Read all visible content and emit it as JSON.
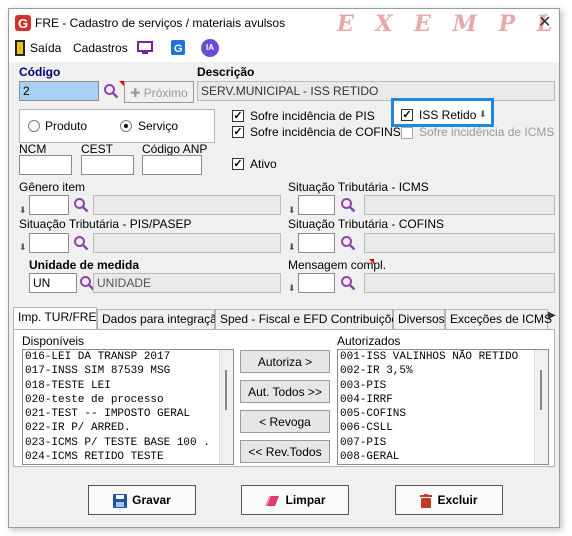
{
  "window": {
    "title": "FRE - Cadastro de serviços / materiais avulsos",
    "watermark": "E X E M P L O",
    "close_glyph": "✕"
  },
  "menu": {
    "exit": "Saída",
    "registers": "Cadastros",
    "ia": "IA"
  },
  "codigo": {
    "label": "Código",
    "value": "2",
    "next_button": "Próximo"
  },
  "descricao": {
    "label": "Descrição",
    "value": "SERV.MUNICIPAL - ISS RETIDO"
  },
  "tipo": {
    "produto": "Produto",
    "servico": "Serviço",
    "selected": "Serviço"
  },
  "flags": {
    "pis": "Sofre incidência de PIS",
    "cofins": "Sofre incidência de COFINS",
    "iss_retido": "ISS Retido",
    "icms": "Sofre incidência de ICMS",
    "ativo": "Ativo"
  },
  "fields": {
    "ncm": "NCM",
    "cest": "CEST",
    "codigo_anp": "Código ANP",
    "genero_item": "Gênero item",
    "sit_icms": "Situação Tributária - ICMS",
    "sit_pis": "Situação Tributária - PIS/PASEP",
    "sit_cofins": "Situação Tributária - COFINS",
    "unidade": "Unidade de medida",
    "unidade_code": "UN",
    "unidade_desc": "UNIDADE",
    "mensagem": "Mensagem compl."
  },
  "tabs": [
    "Imp. TUR/FRE",
    "Dados para integração",
    "Sped - Fiscal e EFD Contribuições",
    "Diversos",
    "Exceções de ICMS"
  ],
  "disponiveis": {
    "label": "Disponíveis",
    "items": [
      "016-LEI DA TRANSP 2017",
      "017-INSS SIM 87539 MSG",
      "018-TESTE LEI",
      "020-teste de processo",
      "021-TEST -- IMPOSTO GERAL",
      "022-IR P/ ARRED.",
      "023-ICMS P/ TESTE BASE 100 .",
      "024-ICMS RETIDO TESTE"
    ]
  },
  "autorizados": {
    "label": "Autorizados",
    "items": [
      "001-ISS VALINHOS NÃO RETIDO",
      "002-IR 3,5%",
      "003-PIS",
      "004-IRRF",
      "005-COFINS",
      "006-CSLL",
      "007-PIS",
      "008-GERAL"
    ]
  },
  "transfer": {
    "autoriza": "Autoriza >",
    "aut_todos": "Aut. Todos >>",
    "revoga": "< Revoga",
    "rev_todos": "<< Rev.Todos"
  },
  "footer": {
    "gravar": "Gravar",
    "limpar": "Limpar",
    "excluir": "Excluir"
  },
  "colors": {
    "highlight": "#1e88e5",
    "selected_input": "#a9d1f5"
  }
}
